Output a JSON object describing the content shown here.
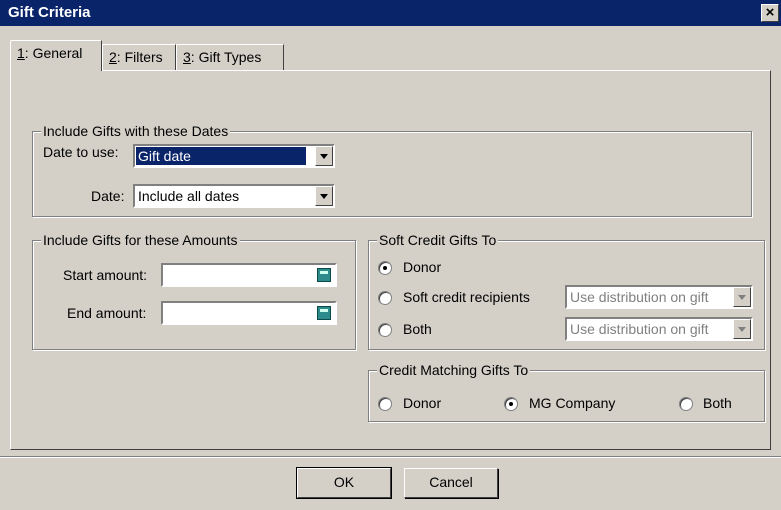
{
  "window": {
    "title": "Gift Criteria",
    "close_glyph": "×"
  },
  "tabs": [
    {
      "key": "1",
      "rest": ": General",
      "active": true
    },
    {
      "key": "2",
      "rest": ": Filters",
      "active": false
    },
    {
      "key": "3",
      "rest": ": Gift Types",
      "active": false
    }
  ],
  "dates_group": {
    "label": "Include Gifts with these Dates",
    "date_to_use_label": "Date to use:",
    "date_to_use_value": "Gift date",
    "date_label": "Date:",
    "date_value": "Include all dates"
  },
  "amounts_group": {
    "label": "Include Gifts for these Amounts",
    "start_label": "Start amount:",
    "start_value": "",
    "end_label": "End amount:",
    "end_value": ""
  },
  "soft_credit_group": {
    "label": "Soft Credit Gifts To",
    "options": [
      {
        "label": "Donor",
        "selected": true
      },
      {
        "label": "Soft credit recipients",
        "selected": false,
        "combo": "Use distribution on gift"
      },
      {
        "label": "Both",
        "selected": false,
        "combo": "Use distribution on gift"
      }
    ]
  },
  "matching_group": {
    "label": "Credit Matching Gifts To",
    "options": [
      {
        "label": "Donor",
        "selected": false
      },
      {
        "label": "MG Company",
        "selected": true
      },
      {
        "label": "Both",
        "selected": false
      }
    ]
  },
  "buttons": {
    "ok": "OK",
    "cancel": "Cancel"
  },
  "icons": {
    "close": "close-icon",
    "calculator": "calculator-icon",
    "dropdown": "chevron-down-icon"
  }
}
